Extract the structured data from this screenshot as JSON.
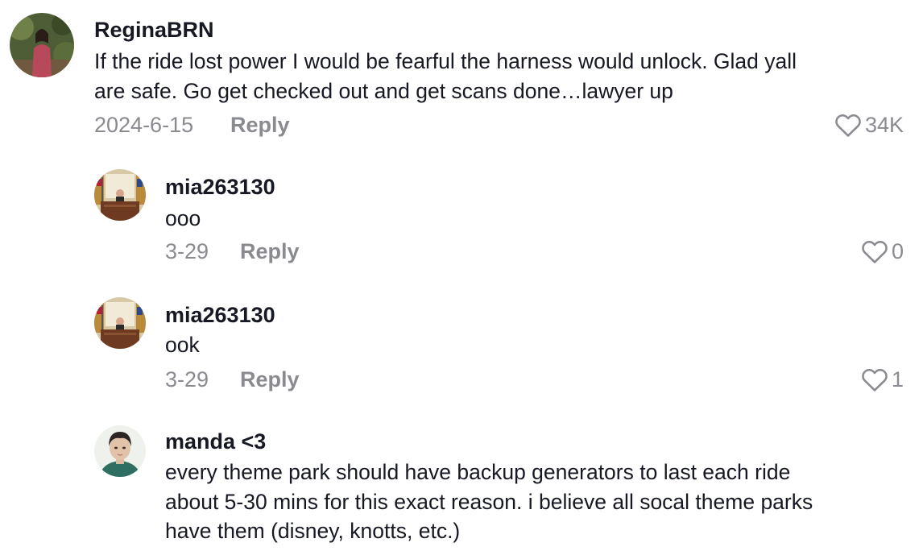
{
  "comments": [
    {
      "username": "ReginaBRN",
      "text": "If the ride lost power I would be fearful the harness would unlock. Glad yall\nare safe. Go get checked out and get scans done…lawyer up",
      "date": "2024-6-15",
      "reply_label": "Reply",
      "likes": "34K"
    },
    {
      "username": "mia263130",
      "text": "ooo",
      "date": "3-29",
      "reply_label": "Reply",
      "likes": "0"
    },
    {
      "username": "mia263130",
      "text": "ook",
      "date": "3-29",
      "reply_label": "Reply",
      "likes": "1"
    },
    {
      "username": "manda <3",
      "text": "every theme park should have backup generators to last each ride\nabout 5-30 mins for this exact reason. i believe all socal theme parks\nhave them (disney, knotts, etc.)"
    }
  ],
  "icons": {
    "like": "heart-outline-icon"
  },
  "colors": {
    "text": "#161823",
    "muted": "#8a8b91"
  }
}
